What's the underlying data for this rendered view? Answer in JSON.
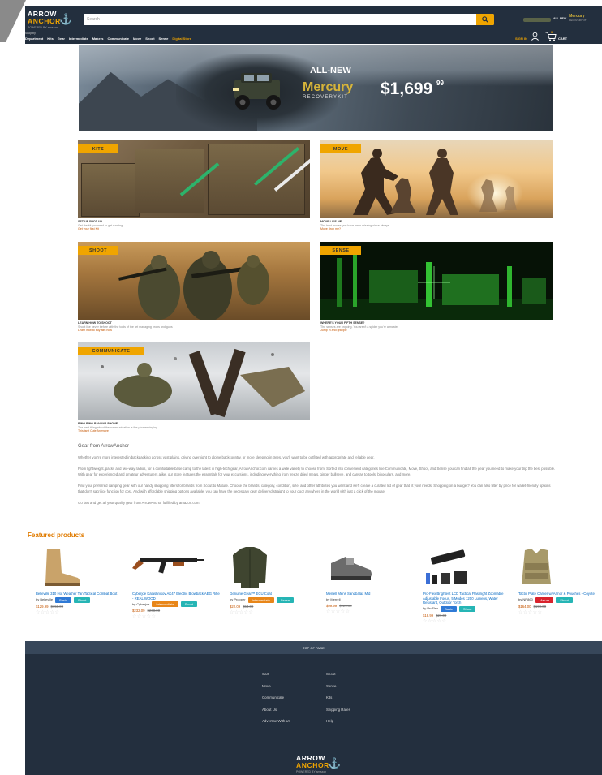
{
  "header": {
    "logo": {
      "line1": "ARROW",
      "line2": "ANCHOR",
      "sub": "POWERED BY amazon"
    },
    "search": {
      "placeholder": "Search"
    },
    "promo": {
      "label": "ALL-NEW",
      "brand": "Mercury",
      "sub": "RECOVERYKIT"
    },
    "shop_by": "Shop by",
    "nav": [
      "Department",
      "Kits",
      "Gear",
      "Intermediate",
      "Makers",
      "Communicate",
      "Move",
      "Shoot",
      "Sense",
      "Digital Store"
    ],
    "sign_in": "SIGN IN",
    "cart_count": "0",
    "cart_label": "CART"
  },
  "hero": {
    "tag": "ALL-NEW",
    "brand": "Mercury",
    "sub": "RECOVERYKIT",
    "price": "$1,699",
    "cents": "99"
  },
  "tiles": [
    {
      "tag": "KITS",
      "heading": "SET UP SHOT UP",
      "text": "Get the kit you need to get running",
      "link": "Get your first Kit"
    },
    {
      "tag": "MOVE",
      "heading": "MOVE LIKE ME",
      "text": "The best moves you have been missing since always",
      "link": "Move drop me?"
    },
    {
      "tag": "SHOOT",
      "heading": "LEARN HOW TO SHOOT",
      "text": "Shoot like never before with the tools of the art managing props and guns",
      "link": "Learn how to buy aim now"
    },
    {
      "tag": "SENSE",
      "heading": "WHERE'S YOUR FIFTH SENSE?",
      "text": "The senses are ongoing. You aren't a spider you're a master",
      "link": "Jump in and grapple"
    },
    {
      "tag": "COMMUNICATE",
      "heading": "RING RING BANANA PHONE",
      "text": "The best thing about the communication is the phones ringing",
      "link": "This isn't Cute Anymore"
    }
  ],
  "description": {
    "title": "Gear from ArrowAnchor",
    "paragraphs": [
      "Whether you're more interested in backpacking across vast plains, driving overnight to alpine backcountry, or more sleeping in trees, you'll want to be outfitted with appropriate and reliable gear.",
      "From lightweight, packs and two-way radios, for a comfortable base camp to the latest in high-tech gear, ArrowAnchor.com carries a wide variety to choose from. Sorted into convenient categories like Communicate, Move, Shoot, and Sense you can find all the gear you need to make your trip the best possible. With gear for experienced and amateur adventurers alike, our store features the essentials for your excursions, including everything from freeze dried meals, ginger bullseye, and canvas to tools, binoculars, and more.",
      "Find your preferred camping gear with our handy shopping filters for brands from Scout to Mature. Choose the brands, category, condition, size, and other attributes you want and we'll create a curated list of gear that fit your needs. Shopping on a budget? You can also filter by price for wallet-friendly options that don't sacrifice function for cost. And with affordable shipping options available, you can have the necessary gear delivered straight to your door anywhere in the world with just a click of the mouse.",
      "Go fast and get all your quality gear from ArrowAnchor fulfilled by amazon.com."
    ]
  },
  "featured": {
    "title": "Featured products",
    "products": [
      {
        "name": "Belleville 310 Hot Weather Tan Tactical Combat Boot",
        "by": "by Belleville",
        "badges": [
          {
            "label": "Basic",
            "color": "blue"
          },
          {
            "label": "Shoot",
            "color": "teal"
          }
        ],
        "price": "$129.99",
        "was": "$150.00",
        "icon": "boot-icon"
      },
      {
        "name": "Cyberjoe Kalashnikov AK47 Electric Blowback AEG Rifle - REAL WOOD",
        "by": "by Cyberjoe",
        "badges": [
          {
            "label": "Intermediate",
            "color": "orange"
          },
          {
            "label": "Shoot",
            "color": "teal"
          }
        ],
        "price": "$232.09",
        "was": "$268.00",
        "icon": "rifle-icon"
      },
      {
        "name": "Genuine Gear™ ECU Coat",
        "by": "by Propper",
        "badges": [
          {
            "label": "Intermediate",
            "color": "orange"
          },
          {
            "label": "Sense",
            "color": "teal"
          }
        ],
        "price": "$22.09",
        "was": "$54.00",
        "icon": "jacket-icon"
      },
      {
        "name": "Merrell Mens Sandbalax Mid",
        "by": "by Merrell",
        "badges": [],
        "price": "$99.99",
        "was": "$120.00",
        "icon": "hiking-shoe-icon"
      },
      {
        "name": "Pro-Flex Brightest LCD Tactical Flashlight Zoomable Adjustable Focus, 5 Modes 1200 Lumens, Water Resistant, Outdoor Torch",
        "by": "by ProFlex",
        "badges": [
          {
            "label": "Basic",
            "color": "blue"
          },
          {
            "label": "Shoot",
            "color": "teal"
          }
        ],
        "price": "$18.99",
        "was": "$27.00",
        "icon": "flashlight-icon"
      },
      {
        "name": "Tactic Plate Carrier w/ Armor & Pouches - Coyote",
        "by": "by NR860",
        "badges": [
          {
            "label": "Mature",
            "color": "red"
          },
          {
            "label": "Shoot",
            "color": "teal"
          }
        ],
        "price": "$164.00",
        "was": "$199.00",
        "icon": "vest-icon"
      }
    ]
  },
  "footer": {
    "top_of_page": "TOP OF PAGE",
    "col1": [
      "Cart",
      "Move",
      "Communicate",
      "About Us",
      "Advertise With Us"
    ],
    "col2": [
      "Shoot",
      "Sense",
      "Kits",
      "Shipping Rates",
      "Help"
    ]
  },
  "colors": {
    "header_bg": "#232f3e",
    "accent": "#f0a500",
    "link": "#0066c0",
    "price": "#c45500",
    "featured": "#e07b00"
  }
}
